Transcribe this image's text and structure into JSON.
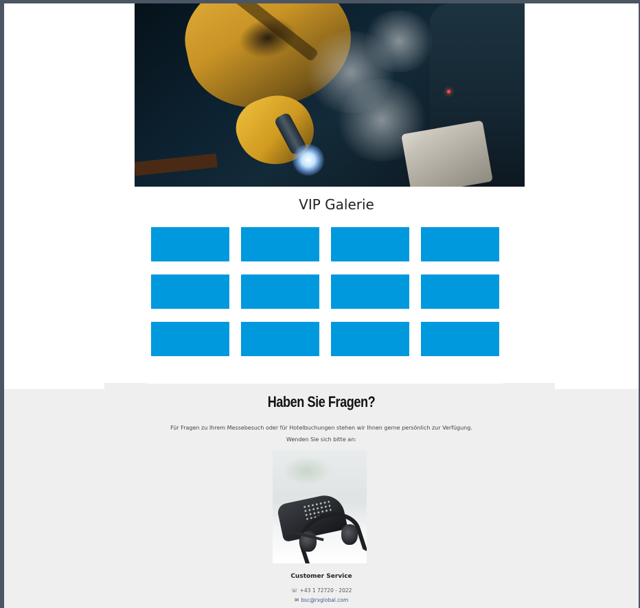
{
  "gallery": {
    "title": "VIP Galerie",
    "tile_count": 12,
    "tile_color": "#0099dd"
  },
  "faq": {
    "heading": "Haben Sie Fragen?",
    "text_line1": "Für Fragen zu Ihrem Messebesuch oder für Hotelbuchungen stehen wir Ihnen gerne persönlich zur Verfügung.",
    "text_line2": "Wenden Sie sich bitte an:",
    "contact": {
      "name": "Customer Service",
      "phone": "+43 1 72720 - 2022",
      "email": "bsc@rxglobal.com",
      "phone_icon": "phone-icon",
      "email_icon": "envelope-icon"
    }
  },
  "colors": {
    "tile": "#0099dd",
    "faq_background": "#efefef",
    "frame": "#4b5563"
  }
}
